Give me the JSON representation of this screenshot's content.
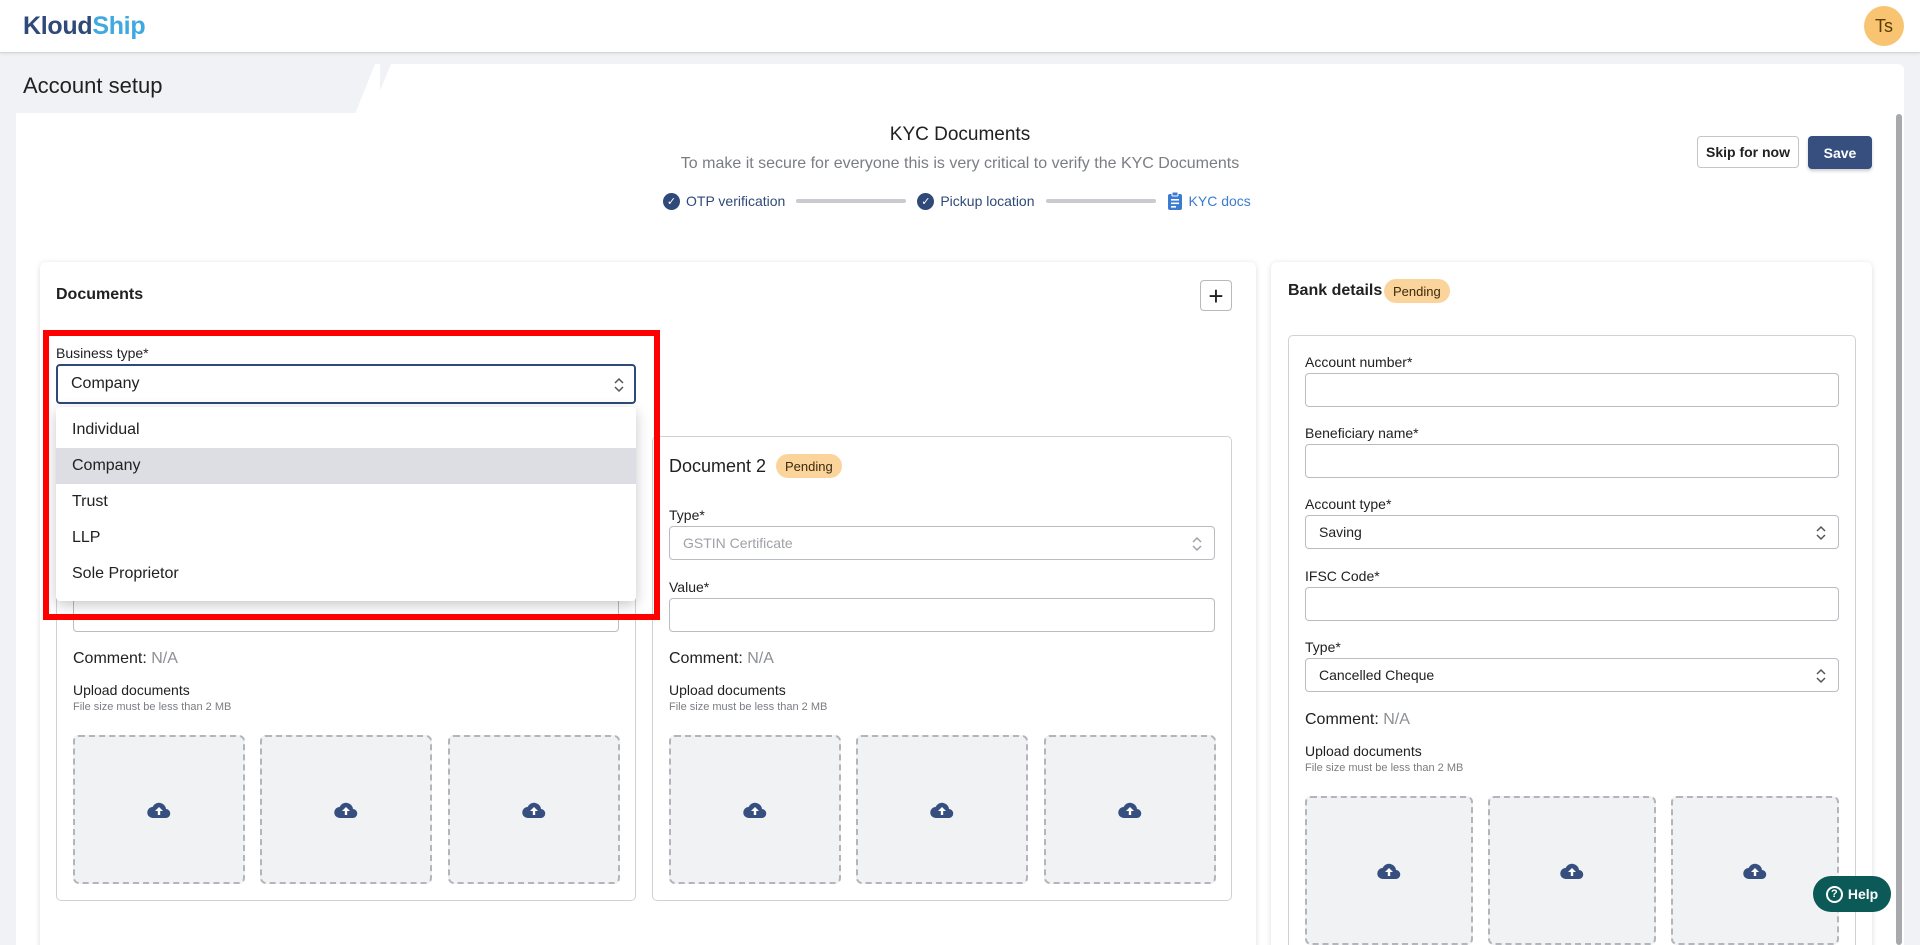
{
  "header": {
    "logo_part1": "Kloud",
    "logo_part2": "Ship",
    "avatar_initials": "Ts"
  },
  "page": {
    "title": "Account setup"
  },
  "kyc": {
    "title": "KYC Documents",
    "subtitle": "To make it secure for everyone this is very critical to verify the KYC Documents",
    "steps": [
      {
        "label": "OTP verification",
        "icon": "check-circle-icon",
        "state": "done"
      },
      {
        "label": "Pickup location",
        "icon": "check-circle-icon",
        "state": "done"
      },
      {
        "label": "KYC docs",
        "icon": "document-icon",
        "state": "active"
      }
    ],
    "skip_label": "Skip for now",
    "save_label": "Save"
  },
  "documents": {
    "title": "Documents",
    "add_icon": "plus-icon",
    "business_type": {
      "label": "Business type*",
      "value": "Company",
      "options": [
        "Individual",
        "Company",
        "Trust",
        "LLP",
        "Sole Proprietor"
      ],
      "selected_index": 1
    },
    "doc1": {
      "comment_label": "Comment:",
      "comment_value": "N/A",
      "upload_label": "Upload documents",
      "upload_note": "File size must be less than 2 MB"
    },
    "doc2": {
      "title": "Document 2",
      "status": "Pending",
      "type_label": "Type*",
      "type_value": "GSTIN Certificate",
      "value_label": "Value*",
      "value_value": "",
      "comment_label": "Comment:",
      "comment_value": "N/A",
      "upload_label": "Upload documents",
      "upload_note": "File size must be less than 2 MB"
    }
  },
  "bank": {
    "title": "Bank details",
    "status": "Pending",
    "account_number_label": "Account number*",
    "account_number_value": "",
    "beneficiary_label": "Beneficiary name*",
    "beneficiary_value": "",
    "account_type_label": "Account type*",
    "account_type_value": "Saving",
    "ifsc_label": "IFSC Code*",
    "ifsc_value": "",
    "type_label": "Type*",
    "type_value": "Cancelled Cheque",
    "comment_label": "Comment:",
    "comment_value": "N/A",
    "upload_label": "Upload documents",
    "upload_note": "File size must be less than 2 MB"
  },
  "help": {
    "label": "Help",
    "icon": "question-circle-icon"
  },
  "colors": {
    "primary": "#364f7e",
    "accent": "#3fa9e0",
    "pending": "#fbd49c",
    "help": "#0b5a57",
    "highlight": "#ff0000"
  }
}
